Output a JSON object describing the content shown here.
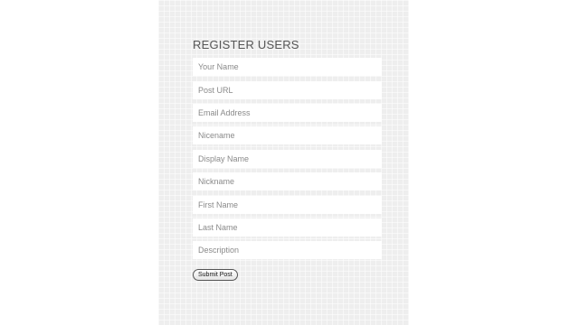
{
  "form": {
    "title": "REGISTER USERS",
    "fields": [
      {
        "name": "your-name-field",
        "placeholder": "Your Name",
        "value": ""
      },
      {
        "name": "post-url-field",
        "placeholder": "Post URL",
        "value": ""
      },
      {
        "name": "email-address-field",
        "placeholder": "Email Address",
        "value": ""
      },
      {
        "name": "nicename-field",
        "placeholder": "Nicename",
        "value": ""
      },
      {
        "name": "display-name-field",
        "placeholder": "Display Name",
        "value": ""
      },
      {
        "name": "nickname-field",
        "placeholder": "Nickname",
        "value": ""
      },
      {
        "name": "first-name-field",
        "placeholder": "First Name",
        "value": ""
      },
      {
        "name": "last-name-field",
        "placeholder": "Last Name",
        "value": ""
      },
      {
        "name": "description-field",
        "placeholder": "Description",
        "value": ""
      }
    ],
    "submit_label": "Submit Post"
  },
  "colors": {
    "panel_background": "#eeeeee",
    "field_background": "#ffffff",
    "title_text": "#555555",
    "placeholder_text": "#8a8a8a"
  }
}
